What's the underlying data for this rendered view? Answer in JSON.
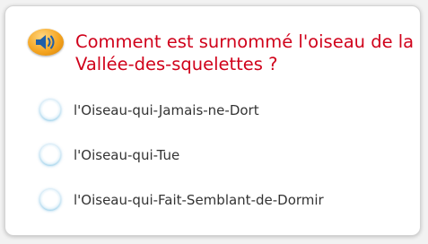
{
  "quiz": {
    "icon": "speaker-icon",
    "question": "Comment est surnommé l'oiseau de la Vallée-des-squelettes ?",
    "colors": {
      "question": "#d0021b",
      "answer_text": "#333333",
      "radio_ring": "#4aa3d6",
      "speaker_bg": "#f5a623"
    },
    "answers": [
      {
        "label": "l'Oiseau-qui-Jamais-ne-Dort"
      },
      {
        "label": "l'Oiseau-qui-Tue"
      },
      {
        "label": "l'Oiseau-qui-Fait-Semblant-de-Dormir"
      }
    ]
  }
}
